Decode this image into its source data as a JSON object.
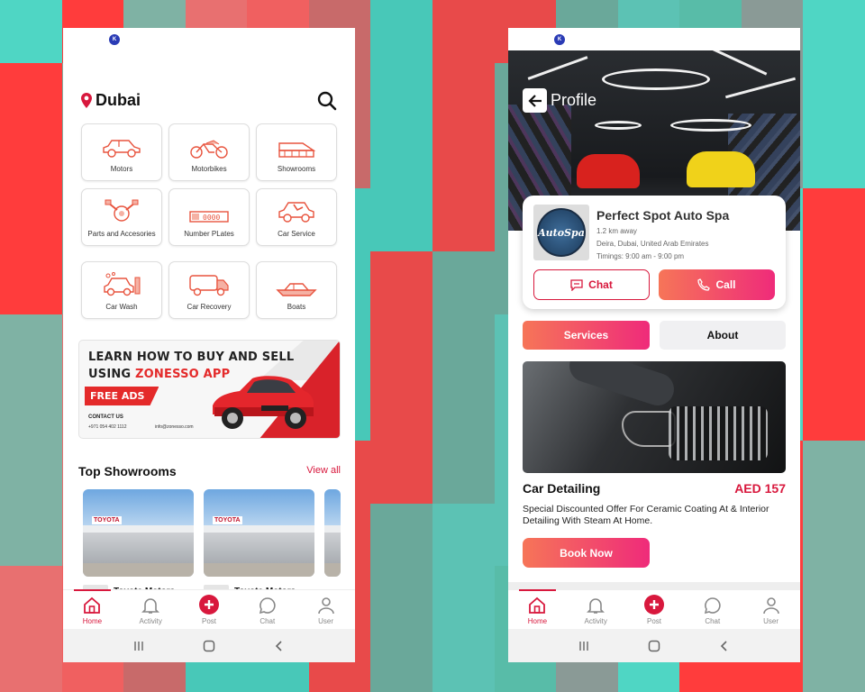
{
  "left": {
    "status_badge": "K",
    "location": "Dubai",
    "categories": [
      {
        "label": "Motors",
        "icon": "car-icon"
      },
      {
        "label": "Motorbikes",
        "icon": "motorbike-icon"
      },
      {
        "label": "Showrooms",
        "icon": "showroom-icon"
      },
      {
        "label": "Parts and Accesories",
        "icon": "engine-parts-icon"
      },
      {
        "label": "Number PLates",
        "icon": "number-plate-icon"
      },
      {
        "label": "Car Service",
        "icon": "car-service-icon"
      },
      {
        "label": "Car Wash",
        "icon": "car-wash-icon"
      },
      {
        "label": "Car Recovery",
        "icon": "car-recovery-icon"
      },
      {
        "label": "Boats",
        "icon": "boat-icon"
      }
    ],
    "banner": {
      "line1": "LEARN HOW TO BUY AND SELL",
      "line2_prefix": "USING ",
      "line2_brand": "ZONESSO APP",
      "free_ads": "FREE ADS",
      "contact": "CONTACT US",
      "phone": "+971 054 402 1112",
      "email": "info@zonesso.com"
    },
    "showrooms_title": "Top Showrooms",
    "view_all": "View all",
    "showrooms": [
      {
        "name": "Toyota Motors",
        "logo": "TOYOTA"
      },
      {
        "name": "Toyota Motors",
        "logo": "TOYOTA"
      }
    ],
    "nav": [
      {
        "label": "Home",
        "icon": "home-icon",
        "active": true
      },
      {
        "label": "Activity",
        "icon": "bell-icon",
        "active": false
      },
      {
        "label": "Post",
        "icon": "plus-icon",
        "active": false
      },
      {
        "label": "Chat",
        "icon": "chat-icon",
        "active": false
      },
      {
        "label": "User",
        "icon": "user-icon",
        "active": false
      }
    ]
  },
  "right": {
    "status_badge": "K",
    "header_title": "Profile",
    "business": {
      "name": "Perfect Spot Auto Spa",
      "distance": "1.2 km away",
      "address": "Deira, Dubai, United Arab Emirates",
      "timings": "Timings: 9:00 am - 9:00 pm",
      "logo_text": "AutoSpa"
    },
    "chat_label": "Chat",
    "call_label": "Call",
    "tabs": {
      "services": "Services",
      "about": "About"
    },
    "service": {
      "title": "Car Detailing",
      "price": "AED 157",
      "description": "Special Discounted Offer For Ceramic Coating At & Interior Detailing With Steam At Home.",
      "book_label": "Book Now"
    },
    "nav": [
      {
        "label": "Home",
        "icon": "home-icon",
        "active": true
      },
      {
        "label": "Activity",
        "icon": "bell-icon",
        "active": false
      },
      {
        "label": "Post",
        "icon": "plus-icon",
        "active": false
      },
      {
        "label": "Chat",
        "icon": "chat-icon",
        "active": false
      },
      {
        "label": "User",
        "icon": "user-icon",
        "active": false
      }
    ]
  },
  "colors": {
    "accent": "#d8183d",
    "gradient_start": "#f67558",
    "gradient_end": "#ef2b7a",
    "banner_red": "#e42a2a"
  }
}
